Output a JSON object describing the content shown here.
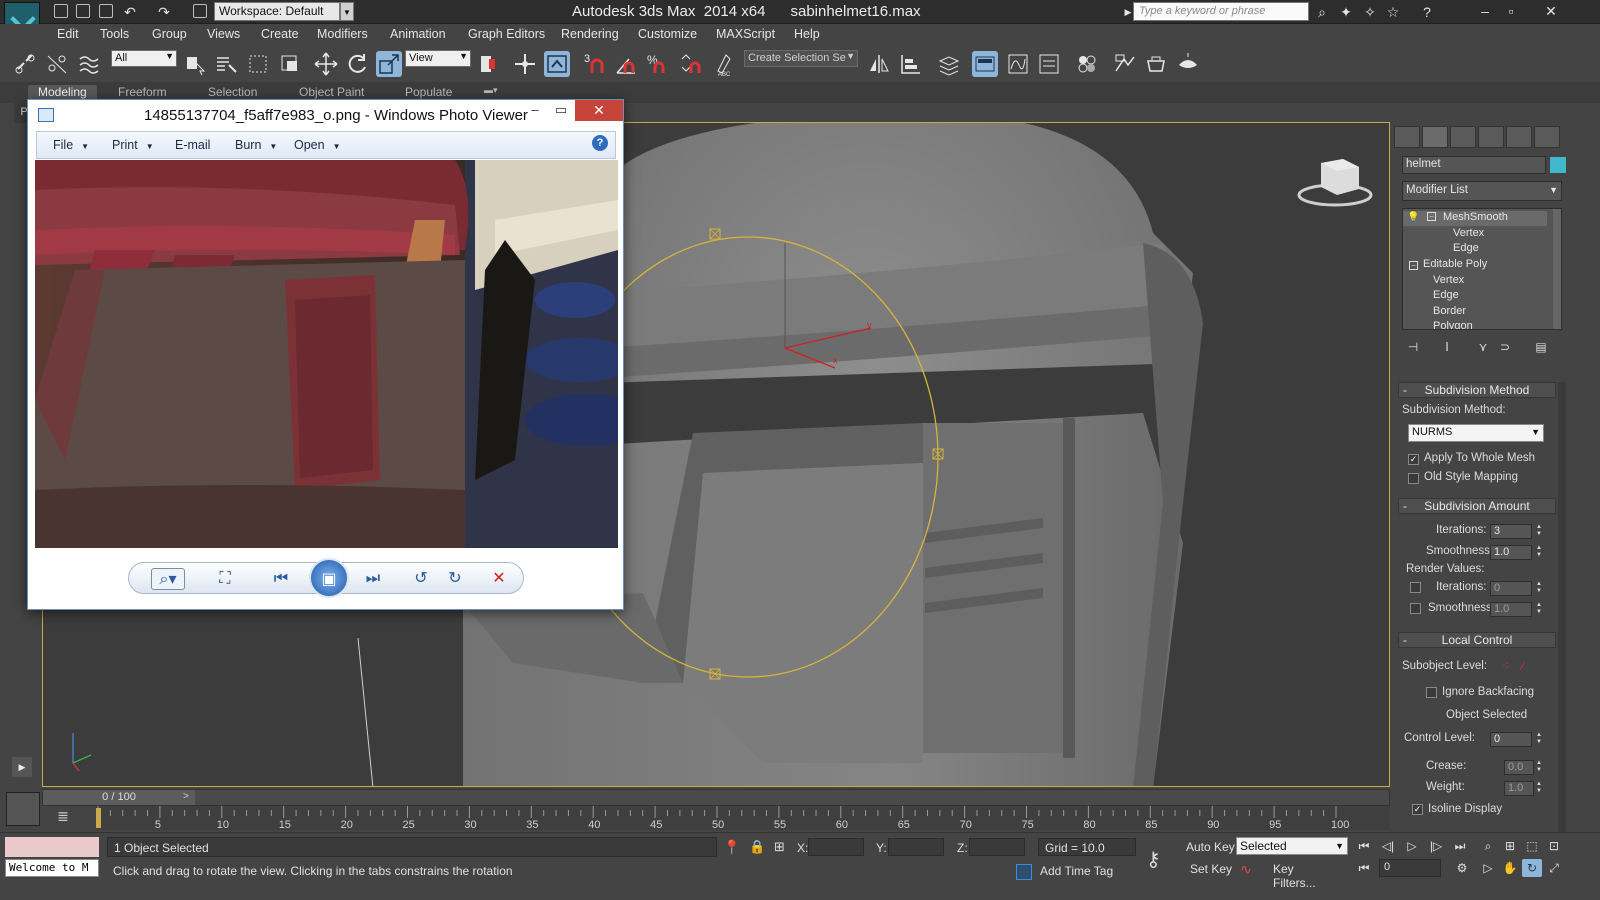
{
  "titlebar": {
    "workspace": "Workspace: Default",
    "app_name": "Autodesk 3ds Max  2014 x64",
    "file_name": "sabinhelmet16.max",
    "search_placeholder": "Type a keyword or phrase"
  },
  "menus": [
    "Edit",
    "Tools",
    "Group",
    "Views",
    "Create",
    "Modifiers",
    "Animation",
    "Graph Editors",
    "Rendering",
    "Customize",
    "MAXScript",
    "Help"
  ],
  "toolbar": {
    "filter_select": "All",
    "coord_system": "View",
    "named_selection": "Create Selection Se"
  },
  "ribbon_tabs": [
    "Modeling",
    "Freeform",
    "Selection",
    "Object Paint",
    "Populate"
  ],
  "photo_viewer": {
    "title": "14855137704_f5aff7e983_o.png - Windows Photo Viewer",
    "menu": [
      "File",
      "Print",
      "E-mail",
      "Burn",
      "Open"
    ],
    "help": "?"
  },
  "command_panel": {
    "object_name": "helmet",
    "object_color": "#3fb8cc",
    "modifier_list": "Modifier List",
    "stack": [
      {
        "label": "MeshSmooth",
        "level": 0
      },
      {
        "label": "Vertex",
        "level": 2
      },
      {
        "label": "Edge",
        "level": 2
      },
      {
        "label": "Editable Poly",
        "level": 0
      },
      {
        "label": "Vertex",
        "level": 1
      },
      {
        "label": "Edge",
        "level": 1
      },
      {
        "label": "Border",
        "level": 1
      },
      {
        "label": "Polygon",
        "level": 1
      }
    ],
    "subdivision_method": {
      "header": "Subdivision Method",
      "label": "Subdivision Method:",
      "value": "NURMS",
      "apply_whole_mesh": "Apply To Whole Mesh",
      "old_style": "Old Style Mapping"
    },
    "subdivision_amount": {
      "header": "Subdivision Amount",
      "iterations_label": "Iterations:",
      "iterations": "3",
      "smoothness_label": "Smoothness:",
      "smoothness": "1.0",
      "render_values": "Render Values:",
      "render_iterations_label": "Iterations:",
      "render_iterations": "0",
      "render_smoothness_label": "Smoothness:",
      "render_smoothness": "1.0"
    },
    "local_control": {
      "header": "Local Control",
      "subobject_level": "Subobject Level:",
      "ignore_backfacing": "Ignore Backfacing",
      "object_selected": "Object Selected",
      "control_level_label": "Control Level:",
      "control_level": "0",
      "crease_label": "Crease:",
      "crease": "0.0",
      "weight_label": "Weight:",
      "weight": "1.0",
      "isoline_display": "Isoline Display"
    }
  },
  "timeline": {
    "slider": "0 / 100",
    "ticks": [
      "5",
      "10",
      "15",
      "20",
      "25",
      "30",
      "35",
      "40",
      "45",
      "50",
      "55",
      "60",
      "65",
      "70",
      "75",
      "80",
      "85",
      "90",
      "95",
      "100"
    ]
  },
  "status": {
    "maxscript": "Welcome to M",
    "selected": "1 Object Selected",
    "prompt": "Click and drag to rotate the view.  Clicking in the tabs constrains the rotation",
    "x_label": "X:",
    "y_label": "Y:",
    "z_label": "Z:",
    "grid": "Grid = 10.0",
    "add_time_tag": "Add Time Tag",
    "auto_key": "Auto Key",
    "set_key": "Set Key",
    "key_mode": "Selected",
    "key_filters": "Key Filters...",
    "frame": "0"
  }
}
